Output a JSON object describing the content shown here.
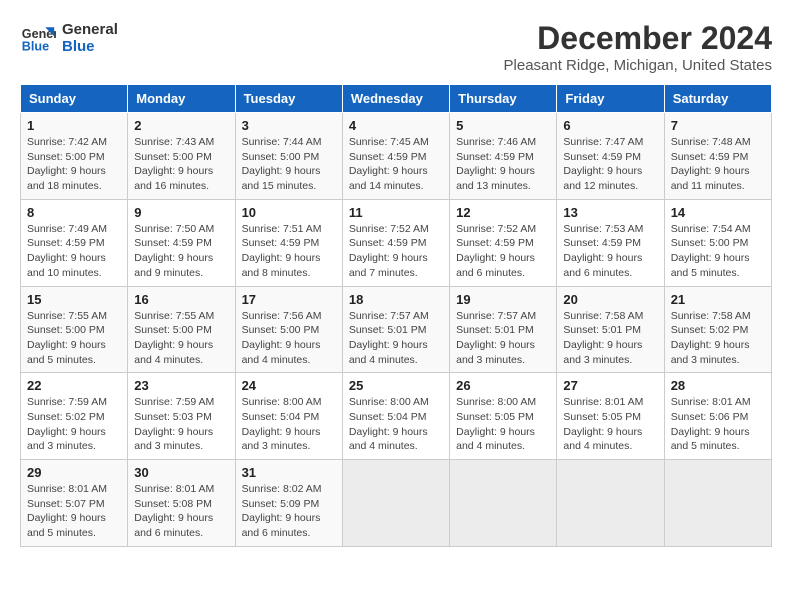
{
  "logo": {
    "line1": "General",
    "line2": "Blue"
  },
  "title": "December 2024",
  "subtitle": "Pleasant Ridge, Michigan, United States",
  "headers": [
    "Sunday",
    "Monday",
    "Tuesday",
    "Wednesday",
    "Thursday",
    "Friday",
    "Saturday"
  ],
  "weeks": [
    [
      {
        "day": "1",
        "info": "Sunrise: 7:42 AM\nSunset: 5:00 PM\nDaylight: 9 hours and 18 minutes."
      },
      {
        "day": "2",
        "info": "Sunrise: 7:43 AM\nSunset: 5:00 PM\nDaylight: 9 hours and 16 minutes."
      },
      {
        "day": "3",
        "info": "Sunrise: 7:44 AM\nSunset: 5:00 PM\nDaylight: 9 hours and 15 minutes."
      },
      {
        "day": "4",
        "info": "Sunrise: 7:45 AM\nSunset: 4:59 PM\nDaylight: 9 hours and 14 minutes."
      },
      {
        "day": "5",
        "info": "Sunrise: 7:46 AM\nSunset: 4:59 PM\nDaylight: 9 hours and 13 minutes."
      },
      {
        "day": "6",
        "info": "Sunrise: 7:47 AM\nSunset: 4:59 PM\nDaylight: 9 hours and 12 minutes."
      },
      {
        "day": "7",
        "info": "Sunrise: 7:48 AM\nSunset: 4:59 PM\nDaylight: 9 hours and 11 minutes."
      }
    ],
    [
      {
        "day": "8",
        "info": "Sunrise: 7:49 AM\nSunset: 4:59 PM\nDaylight: 9 hours and 10 minutes."
      },
      {
        "day": "9",
        "info": "Sunrise: 7:50 AM\nSunset: 4:59 PM\nDaylight: 9 hours and 9 minutes."
      },
      {
        "day": "10",
        "info": "Sunrise: 7:51 AM\nSunset: 4:59 PM\nDaylight: 9 hours and 8 minutes."
      },
      {
        "day": "11",
        "info": "Sunrise: 7:52 AM\nSunset: 4:59 PM\nDaylight: 9 hours and 7 minutes."
      },
      {
        "day": "12",
        "info": "Sunrise: 7:52 AM\nSunset: 4:59 PM\nDaylight: 9 hours and 6 minutes."
      },
      {
        "day": "13",
        "info": "Sunrise: 7:53 AM\nSunset: 4:59 PM\nDaylight: 9 hours and 6 minutes."
      },
      {
        "day": "14",
        "info": "Sunrise: 7:54 AM\nSunset: 5:00 PM\nDaylight: 9 hours and 5 minutes."
      }
    ],
    [
      {
        "day": "15",
        "info": "Sunrise: 7:55 AM\nSunset: 5:00 PM\nDaylight: 9 hours and 5 minutes."
      },
      {
        "day": "16",
        "info": "Sunrise: 7:55 AM\nSunset: 5:00 PM\nDaylight: 9 hours and 4 minutes."
      },
      {
        "day": "17",
        "info": "Sunrise: 7:56 AM\nSunset: 5:00 PM\nDaylight: 9 hours and 4 minutes."
      },
      {
        "day": "18",
        "info": "Sunrise: 7:57 AM\nSunset: 5:01 PM\nDaylight: 9 hours and 4 minutes."
      },
      {
        "day": "19",
        "info": "Sunrise: 7:57 AM\nSunset: 5:01 PM\nDaylight: 9 hours and 3 minutes."
      },
      {
        "day": "20",
        "info": "Sunrise: 7:58 AM\nSunset: 5:01 PM\nDaylight: 9 hours and 3 minutes."
      },
      {
        "day": "21",
        "info": "Sunrise: 7:58 AM\nSunset: 5:02 PM\nDaylight: 9 hours and 3 minutes."
      }
    ],
    [
      {
        "day": "22",
        "info": "Sunrise: 7:59 AM\nSunset: 5:02 PM\nDaylight: 9 hours and 3 minutes."
      },
      {
        "day": "23",
        "info": "Sunrise: 7:59 AM\nSunset: 5:03 PM\nDaylight: 9 hours and 3 minutes."
      },
      {
        "day": "24",
        "info": "Sunrise: 8:00 AM\nSunset: 5:04 PM\nDaylight: 9 hours and 3 minutes."
      },
      {
        "day": "25",
        "info": "Sunrise: 8:00 AM\nSunset: 5:04 PM\nDaylight: 9 hours and 4 minutes."
      },
      {
        "day": "26",
        "info": "Sunrise: 8:00 AM\nSunset: 5:05 PM\nDaylight: 9 hours and 4 minutes."
      },
      {
        "day": "27",
        "info": "Sunrise: 8:01 AM\nSunset: 5:05 PM\nDaylight: 9 hours and 4 minutes."
      },
      {
        "day": "28",
        "info": "Sunrise: 8:01 AM\nSunset: 5:06 PM\nDaylight: 9 hours and 5 minutes."
      }
    ],
    [
      {
        "day": "29",
        "info": "Sunrise: 8:01 AM\nSunset: 5:07 PM\nDaylight: 9 hours and 5 minutes."
      },
      {
        "day": "30",
        "info": "Sunrise: 8:01 AM\nSunset: 5:08 PM\nDaylight: 9 hours and 6 minutes."
      },
      {
        "day": "31",
        "info": "Sunrise: 8:02 AM\nSunset: 5:09 PM\nDaylight: 9 hours and 6 minutes."
      },
      {
        "day": "",
        "info": ""
      },
      {
        "day": "",
        "info": ""
      },
      {
        "day": "",
        "info": ""
      },
      {
        "day": "",
        "info": ""
      }
    ]
  ]
}
